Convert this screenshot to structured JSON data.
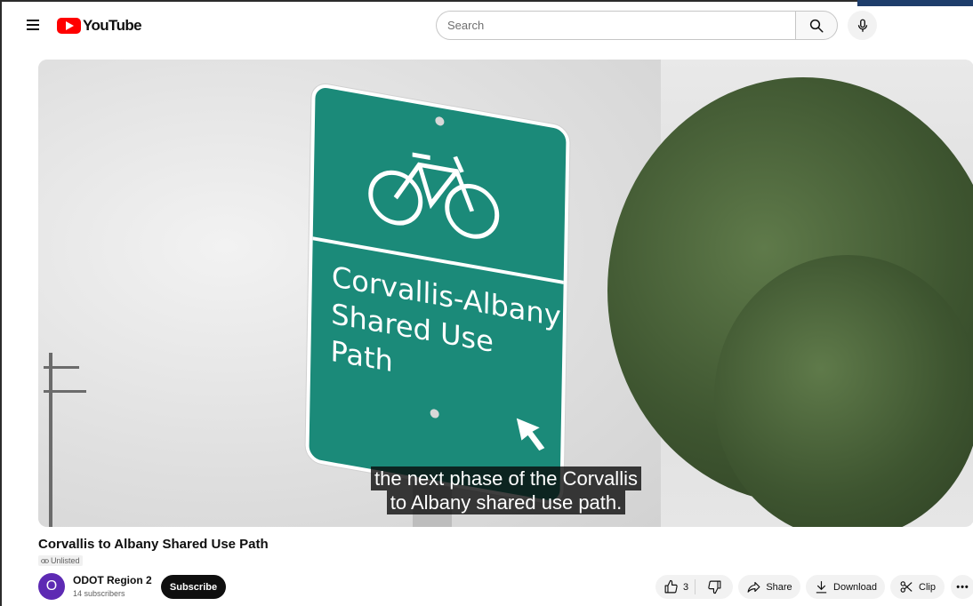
{
  "header": {
    "logo_text": "YouTube",
    "search_placeholder": "Search"
  },
  "video": {
    "sign_lines": [
      "Corvallis-Albany",
      "Shared Use",
      "Path"
    ],
    "caption_lines": [
      "the next phase of the Corvallis",
      "to Albany shared use path."
    ]
  },
  "info": {
    "title": "Corvallis to Albany Shared Use Path",
    "visibility": "Unlisted",
    "channel_initial": "O",
    "channel_name": "ODOT Region 2",
    "subscribers": "14 subscribers",
    "subscribe_label": "Subscribe"
  },
  "actions": {
    "like_count": "3",
    "share_label": "Share",
    "download_label": "Download",
    "clip_label": "Clip",
    "more_label": "•••"
  },
  "colors": {
    "brand_red": "#ff0000",
    "sign_green": "#1b8a79",
    "avatar_purple": "#5d2ab3"
  }
}
